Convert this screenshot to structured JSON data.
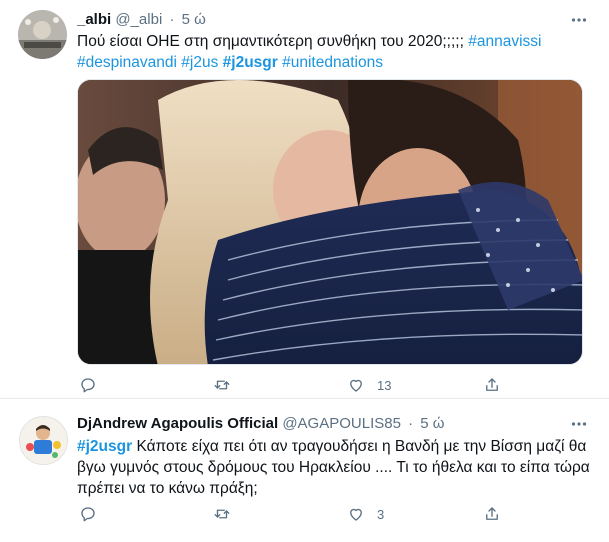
{
  "tweets": [
    {
      "name": "_albi",
      "handle": "@_albi",
      "time": "5 ώ",
      "text_segments": [
        {
          "text": "Πού είσαι ΟΗΕ στη σημαντικότερη συνθήκη του 2020;;;;; ",
          "type": "plain"
        },
        {
          "text": "#annavissi",
          "type": "tag"
        },
        {
          "text": " ",
          "type": "plain"
        },
        {
          "text": "#despinavandi",
          "type": "tag"
        },
        {
          "text": " ",
          "type": "plain"
        },
        {
          "text": "#j2us",
          "type": "tag"
        },
        {
          "text": " ",
          "type": "plain"
        },
        {
          "text": "#j2usgr",
          "type": "tag-bold"
        },
        {
          "text": " ",
          "type": "plain"
        },
        {
          "text": "#unitednations",
          "type": "tag"
        }
      ],
      "has_media": true,
      "reply_count": "",
      "retweet_count": "",
      "like_count": "13"
    },
    {
      "name": "DjAndrew Agapoulis Official",
      "handle": "@AGAPOULIS85",
      "time": "5 ώ",
      "text_segments": [
        {
          "text": "#j2usgr",
          "type": "tag-bold"
        },
        {
          "text": " Κάποτε είχα πει ότι αν τραγουδήσει η Βανδή με την Βίσση μαζί θα βγω γυμνός στους δρόμους του Ηρακλείου .... Τι το ήθελα και το είπα τώρα πρέπει να το κάνω πράξη;",
          "type": "plain"
        }
      ],
      "has_media": false,
      "reply_count": "",
      "retweet_count": "",
      "like_count": "3"
    }
  ],
  "colors": {
    "link": "#1b95e0",
    "secondary": "#5b7083",
    "primary": "#0f1419",
    "divider": "#e6ecf0"
  },
  "icons": {
    "more": "more-dots-icon",
    "reply": "reply-icon",
    "retweet": "retweet-icon",
    "like": "heart-icon",
    "share": "share-icon"
  }
}
